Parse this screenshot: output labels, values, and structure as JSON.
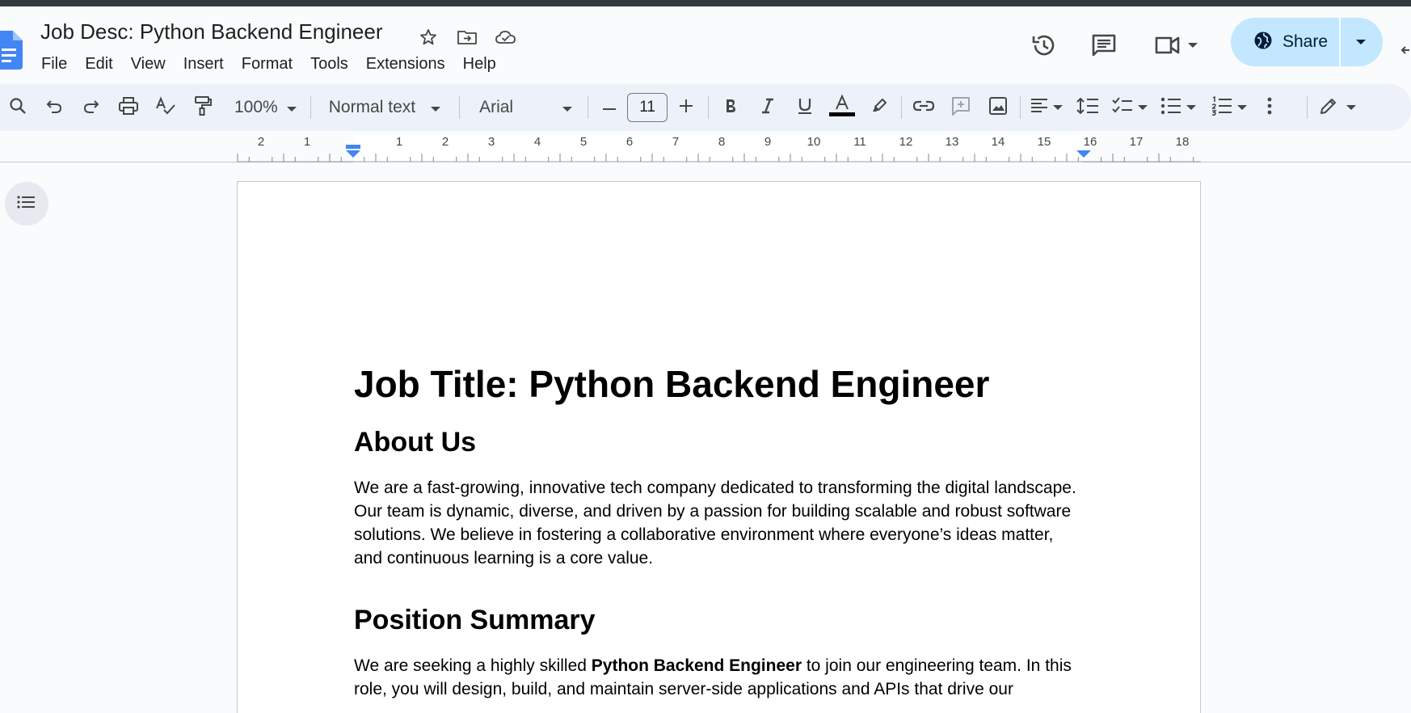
{
  "app": {
    "doc_title": "Job Desc: Python Backend Engineer",
    "menu": [
      "File",
      "Edit",
      "View",
      "Insert",
      "Format",
      "Tools",
      "Extensions",
      "Help"
    ],
    "share_label": "Share"
  },
  "toolbar": {
    "zoom": "100%",
    "style": "Normal text",
    "font": "Arial",
    "font_size": "11",
    "text_color": "#000000"
  },
  "ruler": {
    "left_labels": [
      "2",
      "1"
    ],
    "right_labels": [
      "1",
      "2",
      "3",
      "4",
      "5",
      "6",
      "7",
      "8",
      "9",
      "10",
      "11",
      "12",
      "13",
      "14",
      "15",
      "16",
      "17",
      "18"
    ]
  },
  "document": {
    "title": "Job Title: Python Backend Engineer",
    "about_heading": "About Us",
    "about_text": "We are a fast-growing, innovative tech company dedicated to transforming the digital landscape. Our team is dynamic, diverse, and driven by a passion for building scalable and robust software solutions. We believe in fostering a collaborative environment where everyone’s ideas matter, and continuous learning is a core value.",
    "summary_heading": "Position Summary",
    "summary_pre": "We are seeking a highly skilled ",
    "summary_bold": "Python Backend Engineer",
    "summary_post": " to join our engineering team. In this role, you will design, build, and maintain server-side applications and APIs that drive our"
  },
  "colors": {
    "accent": "#c2e7ff",
    "toolbar_bg": "#edf2fa",
    "page_bg": "#f9fbfd",
    "docs_blue": "#4285f4"
  },
  "icons": {
    "header": [
      "star-icon",
      "move-folder-icon",
      "cloud-saved-icon",
      "version-history-icon",
      "comments-icon",
      "meet-icon",
      "globe-icon"
    ],
    "toolbar": [
      "search-icon",
      "undo-icon",
      "redo-icon",
      "print-icon",
      "spellcheck-icon",
      "paint-format-icon",
      "bold-icon",
      "italic-icon",
      "underline-icon",
      "text-color-icon",
      "highlight-icon",
      "link-icon",
      "add-comment-icon",
      "image-icon",
      "align-left-icon",
      "line-spacing-icon",
      "checklist-icon",
      "bulleted-list-icon",
      "numbered-list-icon",
      "more-icon",
      "editing-mode-icon"
    ]
  }
}
